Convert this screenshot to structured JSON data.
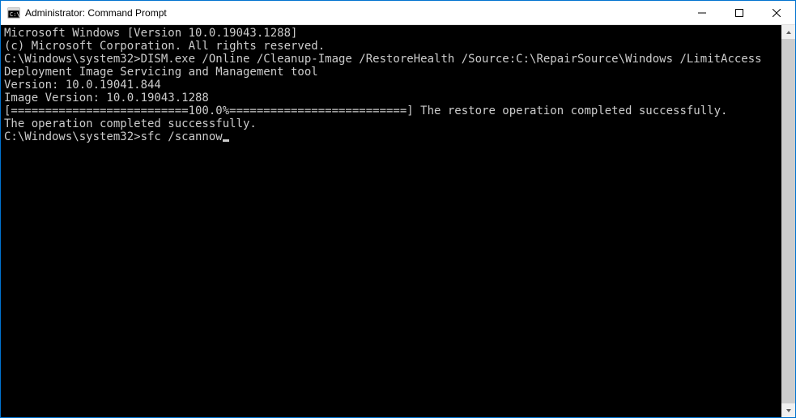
{
  "window": {
    "title": "Administrator: Command Prompt"
  },
  "terminal": {
    "lines": [
      "Microsoft Windows [Version 10.0.19043.1288]",
      "(c) Microsoft Corporation. All rights reserved.",
      "",
      "C:\\Windows\\system32>DISM.exe /Online /Cleanup-Image /RestoreHealth /Source:C:\\RepairSource\\Windows /LimitAccess",
      "",
      "Deployment Image Servicing and Management tool",
      "Version: 10.0.19041.844",
      "",
      "Image Version: 10.0.19043.1288",
      "",
      "[==========================100.0%==========================] The restore operation completed successfully.",
      "The operation completed successfully.",
      "",
      "C:\\Windows\\system32>sfc /scannow"
    ]
  }
}
